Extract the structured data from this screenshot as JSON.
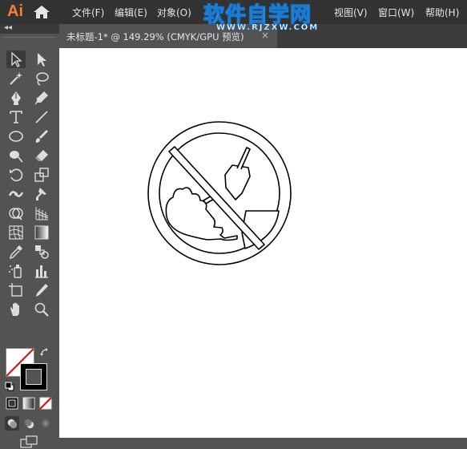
{
  "app": {
    "logo": "Ai"
  },
  "menu": {
    "file": "文件(F)",
    "edit": "编辑(E)",
    "object": "对象(O)",
    "view": "视图(V)",
    "window": "窗口(W)",
    "help": "帮助(H)"
  },
  "watermark": {
    "main": "软件自学网",
    "sub": "WWW.RJZXW.COM"
  },
  "document": {
    "tab_title": "未标题-1* @ 149.29% (CMYK/GPU 预览)",
    "close": "×"
  },
  "toolbar": {
    "collapse": "◂◂",
    "tools": [
      "selection-tool",
      "direct-selection-tool",
      "magic-wand-tool",
      "lasso-tool",
      "pen-tool",
      "curvature-tool",
      "type-tool",
      "line-segment-tool",
      "ellipse-tool",
      "paintbrush-tool",
      "shaper-tool",
      "eraser-tool",
      "rotate-tool",
      "scale-tool",
      "width-tool",
      "puppet-warp-tool",
      "shape-builder-tool",
      "perspective-grid-tool",
      "mesh-tool",
      "gradient-tool",
      "eyedropper-tool",
      "blend-tool",
      "symbol-sprayer-tool",
      "column-graph-tool",
      "artboard-tool",
      "slice-tool",
      "hand-tool",
      "zoom-tool"
    ]
  },
  "colors": {
    "menubar": "#323232",
    "panel": "#535353",
    "canvas": "#ffffff",
    "logo": "#f27e38",
    "watermark": "#1a7bd4"
  }
}
